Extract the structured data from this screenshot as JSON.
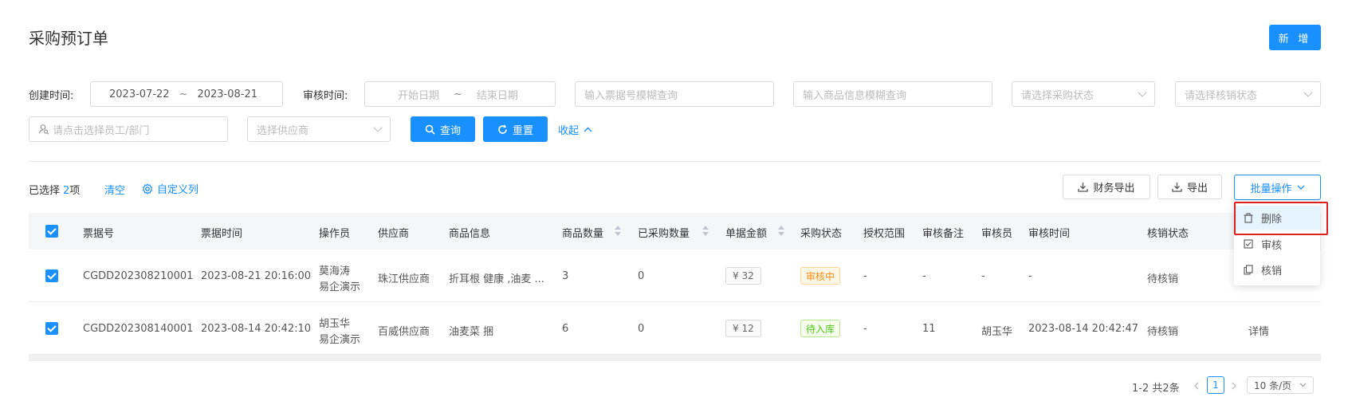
{
  "header": {
    "title": "采购预订单",
    "new_label": "新 增"
  },
  "filters": {
    "created_label": "创建时间:",
    "created_start": "2023-07-22",
    "created_sep": "~",
    "created_end": "2023-08-21",
    "audit_label": "审核时间:",
    "audit_start_ph": "开始日期",
    "audit_sep": "~",
    "audit_end_ph": "结束日期",
    "bill_no_ph": "输入票据号模糊查询",
    "goods_ph": "输入商品信息模糊查询",
    "purchase_status_ph": "请选择采购状态",
    "writeoff_status_ph": "请选择核销状态",
    "employee_ph": "请点击选择员工/部门",
    "supplier_ph": "选择供应商",
    "query_label": "查询",
    "reset_label": "重置",
    "collapse_label": "收起"
  },
  "toolbar": {
    "selected_prefix": "已选择",
    "selected_count": "2",
    "selected_suffix": "项",
    "clear_label": "清空",
    "custom_cols_label": "自定义列",
    "finance_export_label": "财务导出",
    "export_label": "导出",
    "batch_label": "批量操作"
  },
  "table": {
    "headers": [
      "票据号",
      "票据时间",
      "操作员",
      "供应商",
      "商品信息",
      "商品数量",
      "已采购数量",
      "单据金额",
      "采购状态",
      "授权范围",
      "审核备注",
      "审核员",
      "审核时间",
      "核销状态"
    ],
    "rows": [
      {
        "bill_no": "CGDD202308210001",
        "bill_time": "2023-08-21 20:16:00",
        "operator_line1": "莫海涛",
        "operator_line2": "易企演示",
        "supplier": "珠江供应商",
        "goods": "折耳根 健康 ,油麦 ...",
        "qty": "3",
        "purchased": "0",
        "amount": "¥ 32",
        "status": "审核中",
        "scope": "-",
        "remark": "-",
        "auditor": "-",
        "audit_time": "-",
        "writeoff": "待核销",
        "action": ""
      },
      {
        "bill_no": "CGDD202308140001",
        "bill_time": "2023-08-14 20:42:10",
        "operator_line1": "胡玉华",
        "operator_line2": "易企演示",
        "supplier": "百威供应商",
        "goods": "油麦菜 捆",
        "qty": "6",
        "purchased": "0",
        "amount": "¥ 12",
        "status": "待入库",
        "scope": "-",
        "remark": "11",
        "auditor": "胡玉华",
        "audit_time": "2023-08-14 20:42:47",
        "writeoff": "待核销",
        "action": "详情"
      }
    ]
  },
  "dropdown": {
    "items": [
      "删除",
      "审核",
      "核销"
    ]
  },
  "pager": {
    "summary": "1-2 共2条",
    "current": "1",
    "size": "10 条/页"
  },
  "colors": {
    "primary": "#1890ff",
    "highlight": "#e02020"
  }
}
